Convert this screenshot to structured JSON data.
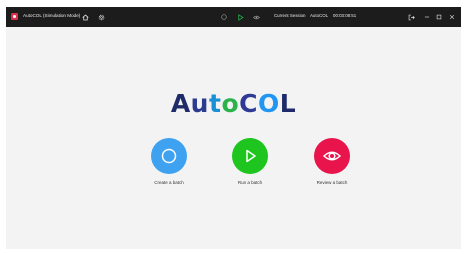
{
  "titlebar": {
    "title": "AutoCOL (Simulation Mode)",
    "home_icon": "home-icon",
    "settings_icon": "gear-icon",
    "stop_icon": "circle-icon",
    "play_icon": "play-icon",
    "eye_icon": "eye-icon",
    "session_label": "Current Session",
    "session_user": "AutoCOL",
    "session_time": "00:03:08:51",
    "colors": {
      "background": "#1c1c1c",
      "play": "#22b14c",
      "text": "#e8e8e8"
    }
  },
  "logo": {
    "letters": [
      {
        "char": "A",
        "color": "#1f2a6b"
      },
      {
        "char": "u",
        "color": "#2b3b8f"
      },
      {
        "char": "t",
        "color": "#1a8fd6"
      },
      {
        "char": "o",
        "color": "#2bb24c"
      },
      {
        "char": "C",
        "color": "#2e3a96"
      },
      {
        "char": "O",
        "color": "#2196f3"
      },
      {
        "char": "L",
        "color": "#1f2a6b"
      }
    ]
  },
  "actions": [
    {
      "label": "Create a batch",
      "icon": "circle-icon",
      "color": "#3ea2f1"
    },
    {
      "label": "Run a batch",
      "icon": "play-icon",
      "color": "#1ec51e"
    },
    {
      "label": "Review a batch",
      "icon": "eye-icon",
      "color": "#e8144b"
    }
  ]
}
